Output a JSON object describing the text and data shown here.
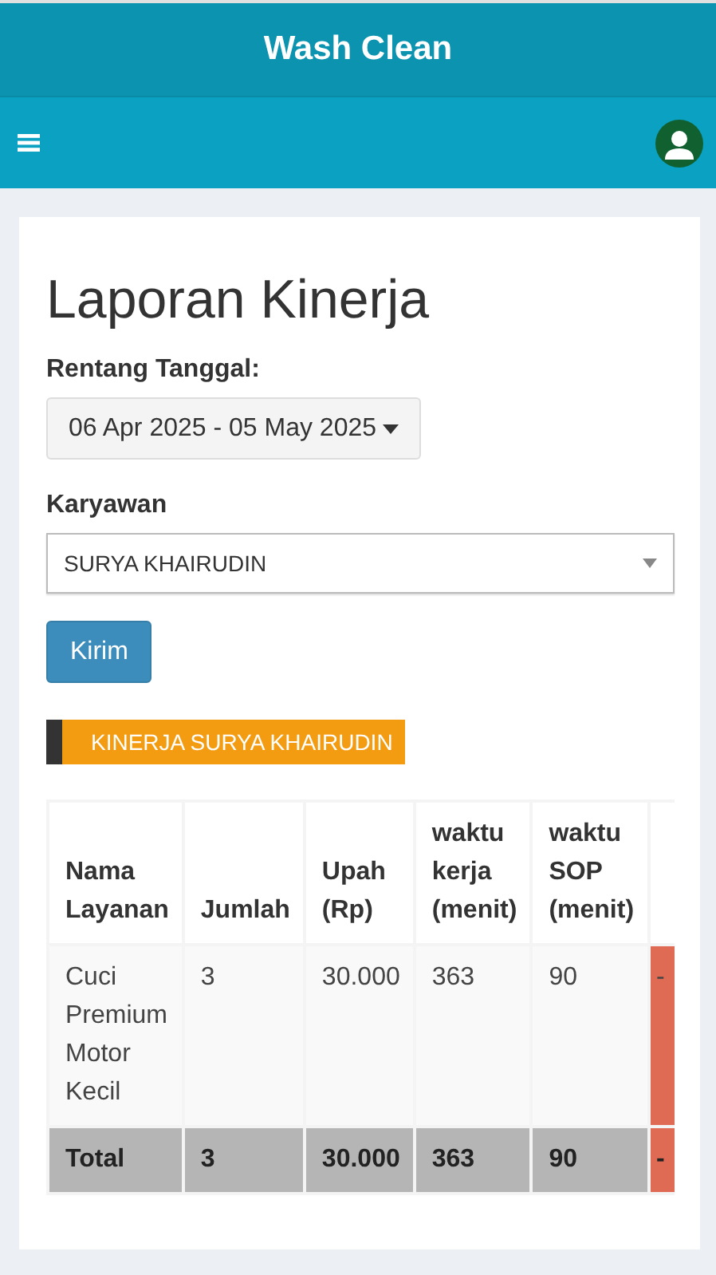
{
  "app_title": "Wash Clean",
  "page_title": "Laporan Kinerja",
  "date_range": {
    "label": "Rentang Tanggal:",
    "value": "06 Apr 2025 - 05 May 2025"
  },
  "employee": {
    "label": "Karyawan",
    "value": "SURYA KHAIRUDIN"
  },
  "submit_button": "Kirim",
  "section_badge": "KINERJA SURYA KHAIRUDIN",
  "table": {
    "columns": [
      "Nama Layanan",
      "Jumlah",
      "Upah (Rp)",
      "waktu kerja (menit)",
      "waktu SOP (menit)",
      ""
    ],
    "rows": [
      {
        "kind": "data",
        "cells": [
          "Cuci Premium Motor Kecil",
          "3",
          "30.000",
          "363",
          "90",
          "-"
        ]
      },
      {
        "kind": "total",
        "cells": [
          "Total",
          "3",
          "30.000",
          "363",
          "90",
          "-"
        ]
      }
    ]
  }
}
